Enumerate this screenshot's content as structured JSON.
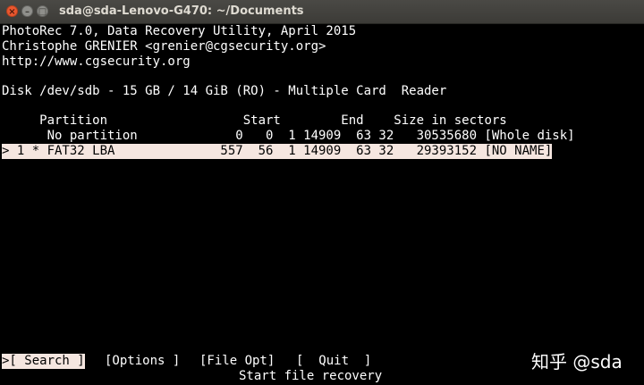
{
  "window": {
    "title": "sda@sda-Lenovo-G470: ~/Documents",
    "close_glyph": "×",
    "minimize_glyph": "–",
    "maximize_glyph": "□"
  },
  "terminal": {
    "header": [
      "PhotoRec 7.0, Data Recovery Utility, April 2015",
      "Christophe GRENIER <grenier@cgsecurity.org>",
      "http://www.cgsecurity.org"
    ],
    "disk_line": "Disk /dev/sdb - 15 GB / 14 GiB (RO) - Multiple Card  Reader",
    "table_header": "     Partition                  Start        End    Size in sectors",
    "partitions": [
      {
        "text": "      No partition             0   0  1 14909  63 32   30535680 [Whole disk]",
        "selected": false
      },
      {
        "text": "> 1 * FAT32 LBA              557  56  1 14909  63 32   29393152 [NO NAME]",
        "selected": true
      }
    ],
    "menu": [
      {
        "label": ">[ Search ]",
        "selected": true
      },
      {
        "label": "[Options ]",
        "selected": false
      },
      {
        "label": "[File Opt]",
        "selected": false
      },
      {
        "label": "[  Quit  ]",
        "selected": false
      }
    ],
    "hint": "Start file recovery"
  },
  "watermark": "知乎 @sda",
  "colors": {
    "terminal_bg": "#000000",
    "terminal_fg": "#ffffff",
    "selection_bg": "#f5e6e0",
    "close_button": "#e9572f",
    "titlebar": "#3c3b37"
  }
}
